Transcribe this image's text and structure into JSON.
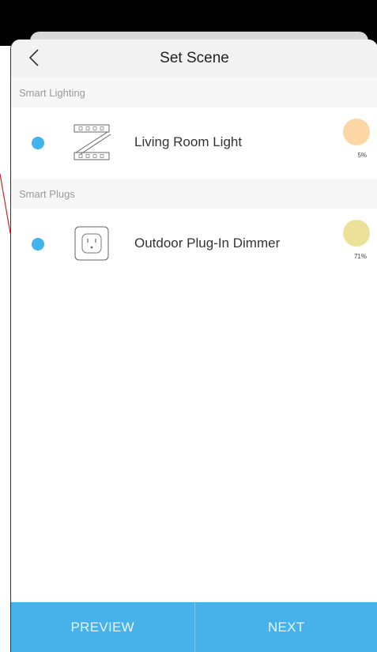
{
  "header": {
    "title": "Set Scene"
  },
  "sections": [
    {
      "title": "Smart Lighting",
      "devices": [
        {
          "name": "Living Room Light",
          "icon": "light-strip-icon",
          "level": "5%",
          "swatch_color": "#fcd6a4",
          "selected": true
        }
      ]
    },
    {
      "title": "Smart Plugs",
      "devices": [
        {
          "name": "Outdoor Plug-In Dimmer",
          "icon": "outlet-icon",
          "level": "71%",
          "swatch_color": "#ece198",
          "selected": true
        }
      ]
    }
  ],
  "footer": {
    "preview_label": "PREVIEW",
    "next_label": "NEXT"
  },
  "colors": {
    "accent": "#47b2e9",
    "radio": "#42b3ee"
  }
}
